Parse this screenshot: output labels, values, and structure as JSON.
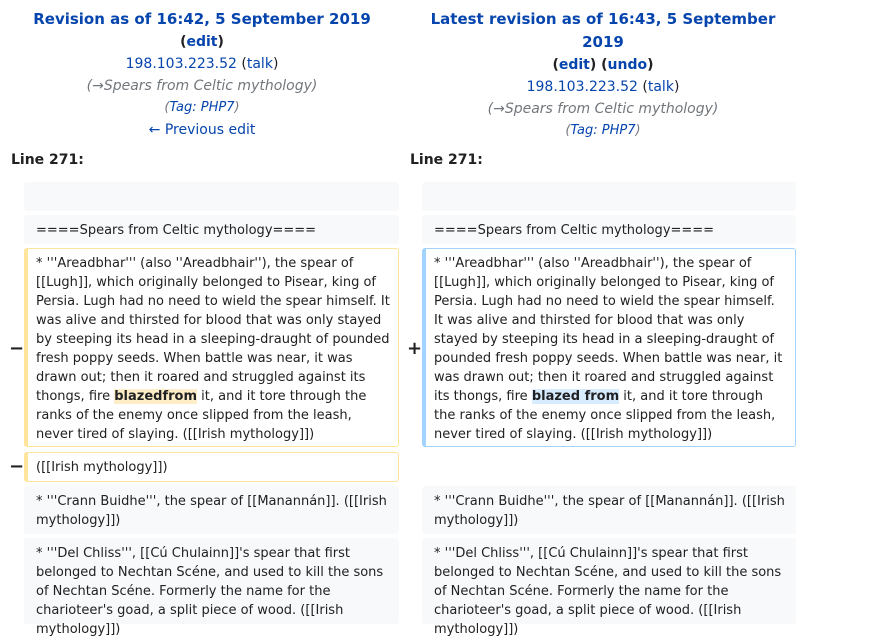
{
  "left": {
    "title": "Revision as of 16:42, 5 September 2019",
    "edit_label": "edit",
    "user": "198.103.223.52",
    "talk_label": "talk",
    "comment": "(→Spears from Celtic mythology)",
    "tag_prefix": "Tag:",
    "tag": "PHP7",
    "prev_edit": "← Previous edit",
    "line": "Line 271:"
  },
  "right": {
    "title": "Latest revision as of 16:43, 5 September 2019",
    "edit_label": "edit",
    "undo_label": "undo",
    "user": "198.103.223.52",
    "talk_label": "talk",
    "comment": "(→Spears from Celtic mythology)",
    "tag_prefix": "Tag:",
    "tag": "PHP7",
    "line": "Line 271:"
  },
  "diff": {
    "empty": "",
    "heading": "====Spears from Celtic mythology====",
    "para_before": "* '''Areadbhar''' (also ''Areadbhair''), the spear of [[Lugh]], which originally belonged to Pisear, king of Persia. Lugh had no need to wield the spear himself. It was alive and thirsted for blood that was only stayed by steeping its head in a sleeping-draught of pounded fresh poppy seeds. When battle was near, it was drawn out; then it roared and struggled against its thongs, fire",
    "old_changed": "blazedfrom",
    "new_changed": "blazed from",
    "para_after": "it, and it tore through the ranks of the enemy once slipped from the leash, never tired of slaying. ([[Irish mythology]])",
    "removed_line": " ([[Irish mythology]])",
    "crann": "* '''Crann Buidhe''', the spear of [[Manannán]]. ([[Irish mythology]])",
    "del_chliss": "* '''Del Chliss''', [[Cú Chulainn]]'s spear that first belonged to Nechtan Scéne, and used to kill the sons of Nechtan Scéne. Formerly the name for the charioteer's goad, a split piece of wood. ([[Irish mythology]])",
    "minus": "−",
    "plus": "+"
  }
}
